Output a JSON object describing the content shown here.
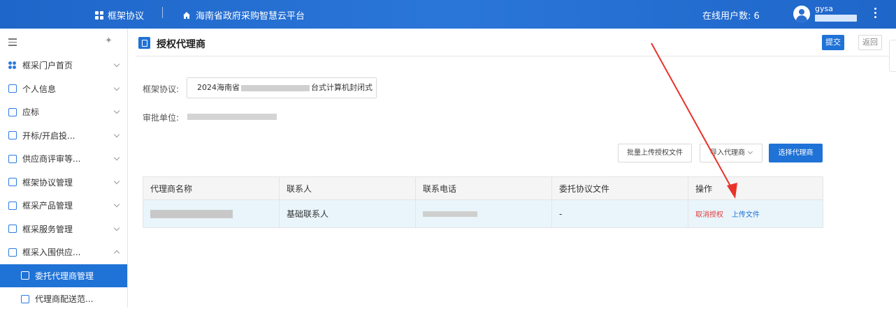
{
  "header": {
    "menu_title": "框架协议",
    "platform_name": "海南省政府采购智慧云平台",
    "online_users_label": "在线用户数:",
    "online_users_count": "6",
    "username": "gysa"
  },
  "sidebar": {
    "items": [
      {
        "label": "框采门户首页",
        "icon": "portal-icon"
      },
      {
        "label": "个人信息",
        "icon": "person-info-icon"
      },
      {
        "label": "应标",
        "icon": "bid-icon"
      },
      {
        "label": "开标/开启投...",
        "icon": "open-bid-icon"
      },
      {
        "label": "供应商评审等...",
        "icon": "review-icon"
      },
      {
        "label": "框架协议管理",
        "icon": "agreement-icon"
      },
      {
        "label": "框采产品管理",
        "icon": "product-icon"
      },
      {
        "label": "框采服务管理",
        "icon": "service-icon"
      },
      {
        "label": "框采入围供应...",
        "icon": "supplier-icon"
      },
      {
        "label": "委托代理商管理",
        "icon": "agent-icon"
      },
      {
        "label": "代理商配送范...",
        "icon": "delivery-icon"
      }
    ]
  },
  "page": {
    "title": "授权代理商",
    "submit_label": "提交",
    "back_label": "返回",
    "framework_label": "框架协议:",
    "framework_value_prefix": "2024海南省",
    "framework_value_suffix": "台式计算机封闭式",
    "approval_label": "审批单位:",
    "batch_upload_label": "批量上传授权文件",
    "import_agent_label": "导入代理商",
    "select_agent_label": "选择代理商"
  },
  "table": {
    "columns": [
      "代理商名称",
      "联系人",
      "联系电话",
      "委托协议文件",
      "操作"
    ],
    "rows": [
      {
        "contact": "基础联系人",
        "agreement_file": "-",
        "cancel_label": "取消授权",
        "upload_label": "上传文件"
      }
    ]
  },
  "colors": {
    "primary": "#1f72d6",
    "danger": "#e23b3b",
    "annotation_arrow": "#e8332a"
  }
}
